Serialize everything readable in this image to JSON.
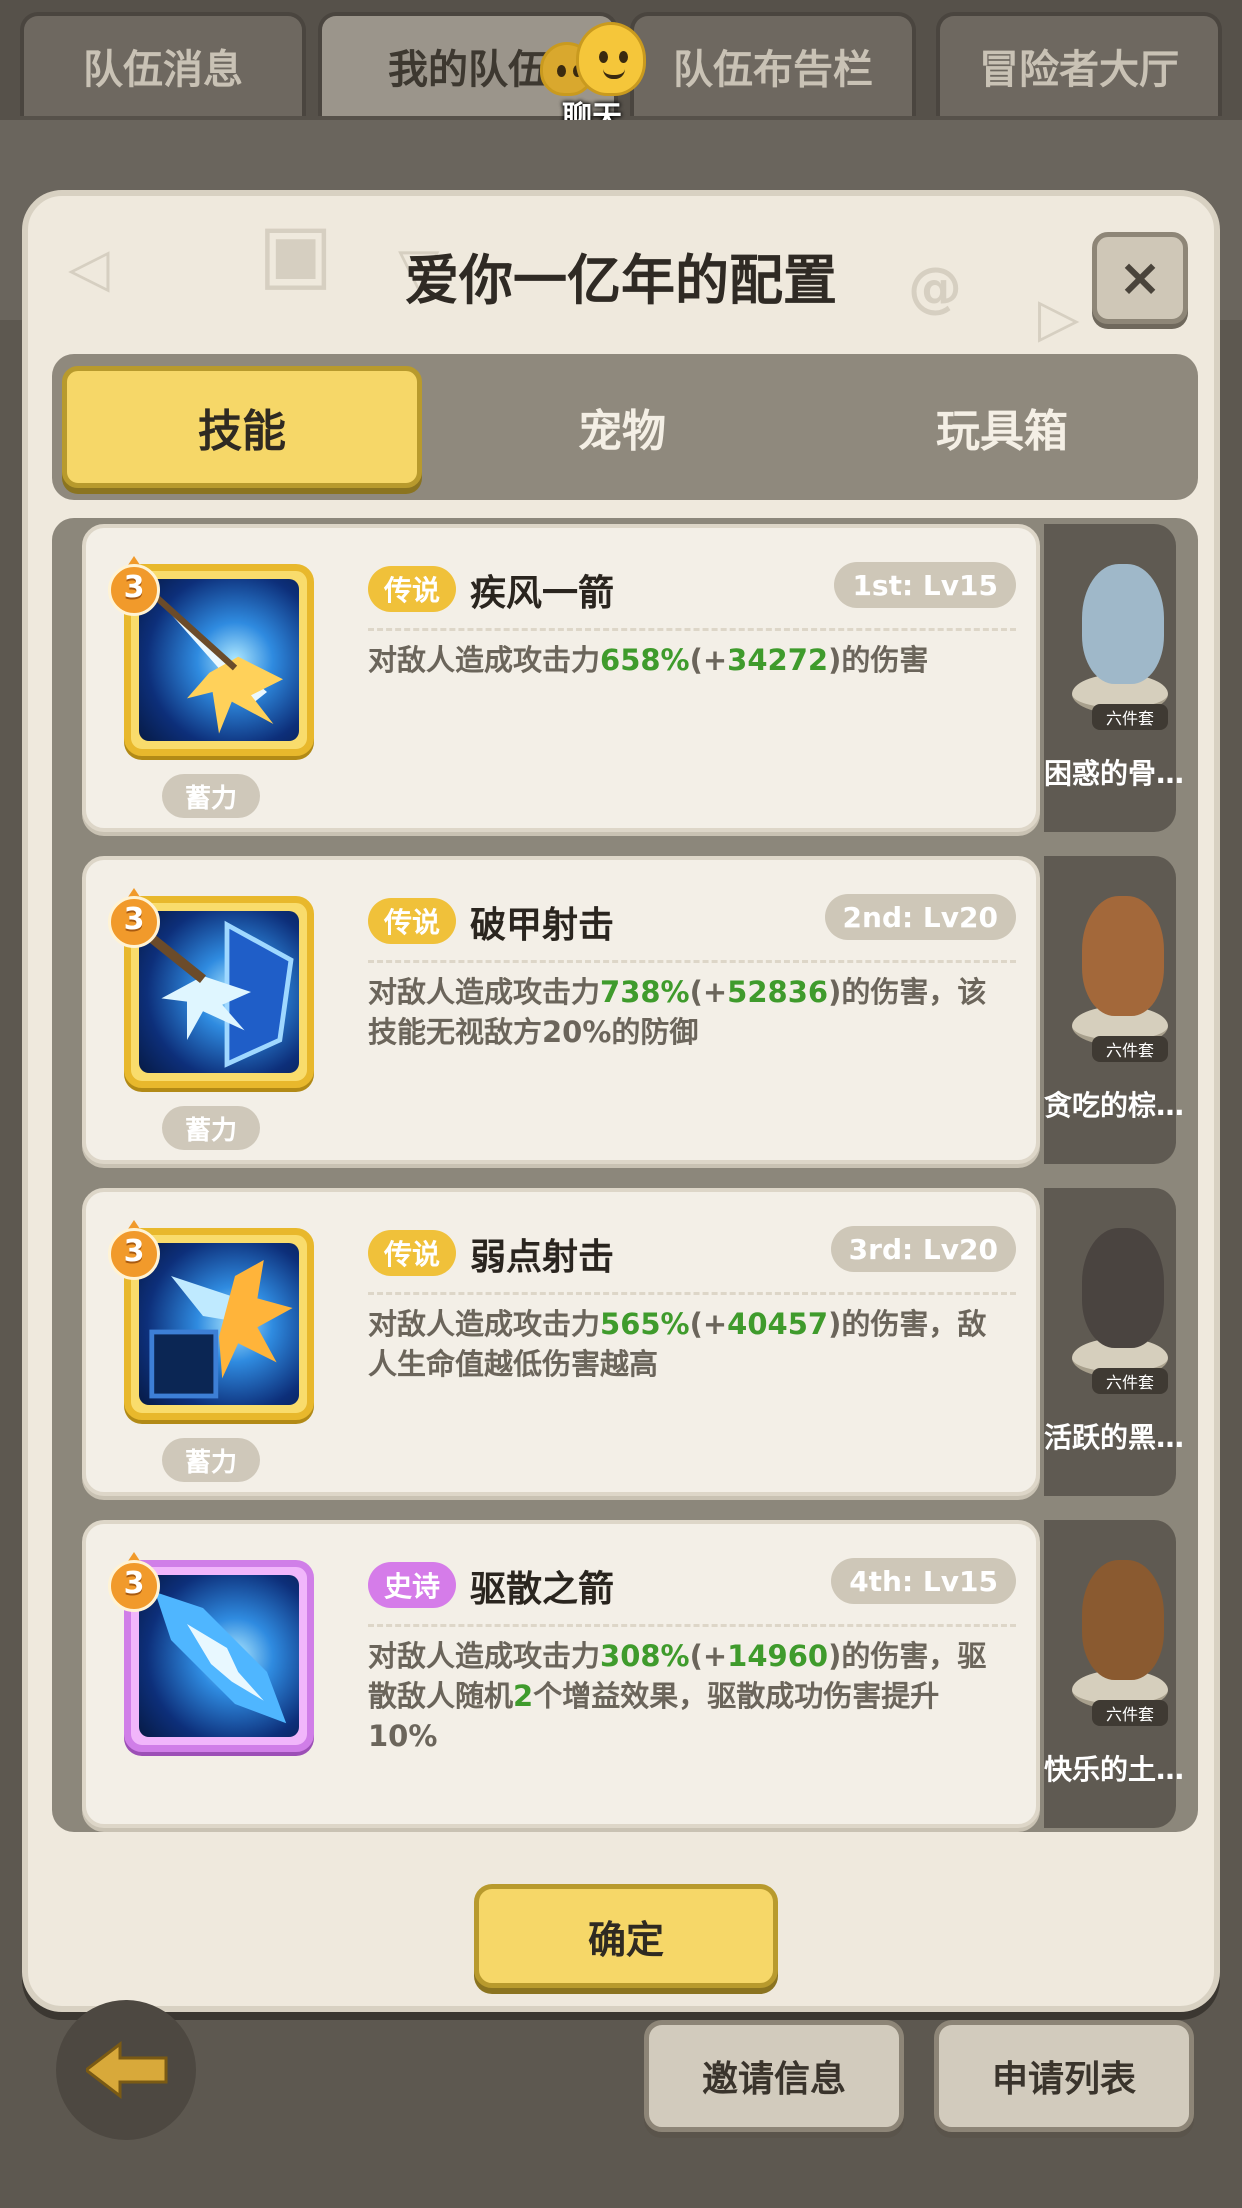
{
  "top_tabs": [
    {
      "label": "队伍消息"
    },
    {
      "label": "我的队伍"
    },
    {
      "label": "队伍布告栏"
    },
    {
      "label": "冒险者大厅"
    }
  ],
  "chat": {
    "label": "聊天"
  },
  "dialog": {
    "title": "爱你一亿年的配置",
    "close_label": "×",
    "tabs": [
      {
        "label": "技能"
      },
      {
        "label": "宠物"
      },
      {
        "label": "玩具箱"
      }
    ],
    "skills": [
      {
        "level": "3",
        "rarity": "传说",
        "name": "疾风一箭",
        "slot": "1st: Lv15",
        "tag": "蓄力",
        "desc_pre": "对敌人造成攻击力",
        "desc_pct": "658%",
        "desc_open": "(+",
        "desc_bonus": "34272",
        "desc_close": ")",
        "desc_post": "的伤害"
      },
      {
        "level": "3",
        "rarity": "传说",
        "name": "破甲射击",
        "slot": "2nd: Lv20",
        "tag": "蓄力",
        "desc_pre": "对敌人造成攻击力",
        "desc_pct": "738%",
        "desc_open": "(+",
        "desc_bonus": "52836",
        "desc_close": ")",
        "desc_post": "的伤害，该技能无视敌方20%的防御"
      },
      {
        "level": "3",
        "rarity": "传说",
        "name": "弱点射击",
        "slot": "3rd: Lv20",
        "tag": "蓄力",
        "desc_pre": "对敌人造成攻击力",
        "desc_pct": "565%",
        "desc_open": "(+",
        "desc_bonus": "40457",
        "desc_close": ")",
        "desc_post": "的伤害，敌人生命值越低伤害越高"
      },
      {
        "level": "3",
        "rarity": "史诗",
        "name": "驱散之箭",
        "slot": "4th: Lv15",
        "desc_pre": "对敌人造成攻击力",
        "desc_pct": "308%",
        "desc_open": "(+",
        "desc_bonus": "14960",
        "desc_close": ")",
        "desc_mid": "的伤害，驱散敌人随机",
        "desc_count": "2",
        "desc_post": "个增益效果，驱散成功伤害提升10%"
      }
    ],
    "pets": [
      {
        "name": "困惑的骨…",
        "set": "六件套",
        "color": "#9fb8c9"
      },
      {
        "name": "贪吃的棕…",
        "set": "六件套",
        "color": "#a3683a"
      },
      {
        "name": "活跃的黑…",
        "set": "六件套",
        "color": "#4a4440"
      },
      {
        "name": "快乐的土…",
        "set": "六件套",
        "color": "#8a5a30"
      }
    ],
    "confirm_label": "确定"
  },
  "bottom": {
    "invite_label": "邀请信息",
    "apply_label": "申请列表"
  }
}
